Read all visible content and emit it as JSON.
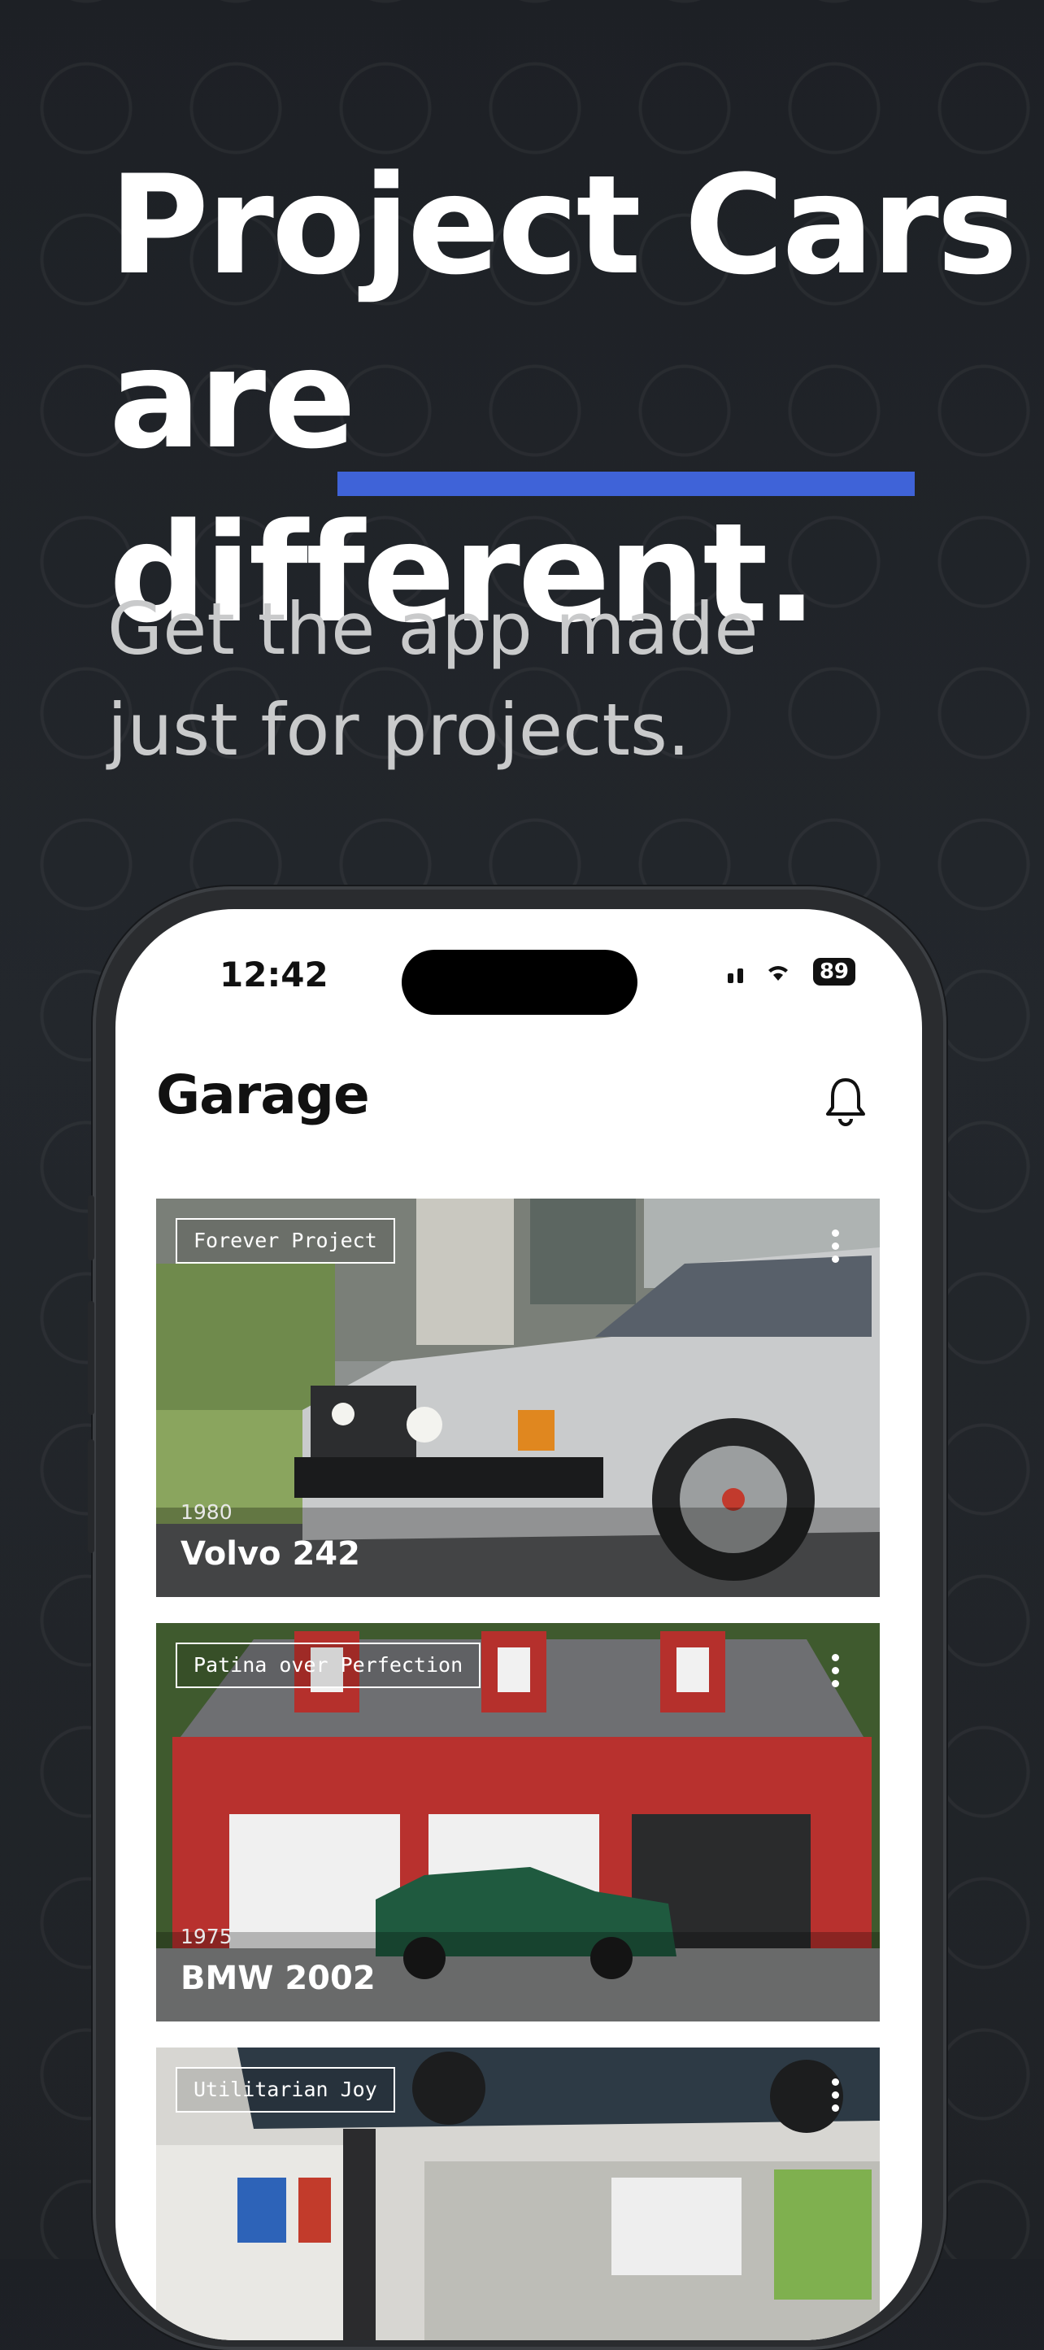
{
  "promo": {
    "headline_line1": "Project Cars",
    "headline_line2_pre": "are ",
    "headline_line2_em": "different.",
    "subhead_line1": "Get the app made",
    "subhead_line2": "just for projects.",
    "accent_color": "#3f63d8",
    "background_color": "#1f2226"
  },
  "status_bar": {
    "time": "12:42",
    "battery": "89",
    "icons": [
      "signal-icon",
      "wifi-icon",
      "battery-icon"
    ]
  },
  "header": {
    "title": "Garage",
    "notification_icon": "bell-icon"
  },
  "garage": {
    "cars": [
      {
        "tag": "Forever Project",
        "year": "1980",
        "name": "Volvo 242"
      },
      {
        "tag": "Patina over Perfection",
        "year": "1975",
        "name": "BMW 2002"
      },
      {
        "tag": "Utilitarian Joy",
        "year": "",
        "name": ""
      }
    ]
  }
}
